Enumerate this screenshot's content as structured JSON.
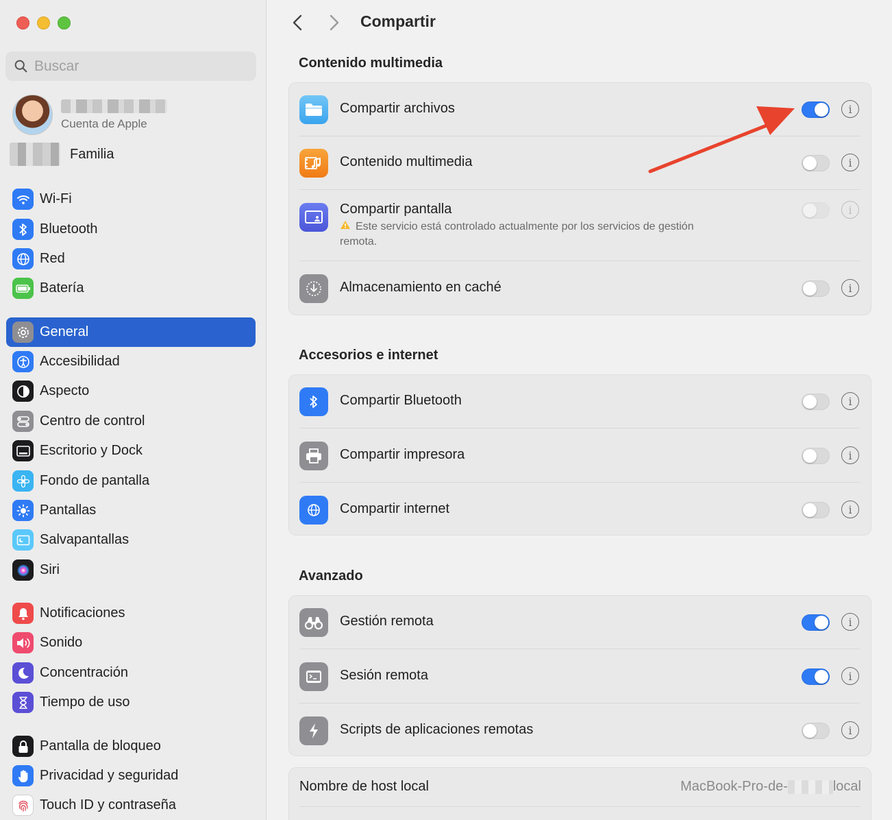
{
  "window": {
    "title": "Compartir"
  },
  "sidebar": {
    "search": {
      "placeholder": "Buscar"
    },
    "account": {
      "subtitle": "Cuenta de Apple"
    },
    "family": {
      "label": "Familia"
    },
    "items": [
      {
        "label": "Wi-Fi",
        "icon": "wifi-icon",
        "color": "#2f7bf5"
      },
      {
        "label": "Bluetooth",
        "icon": "bluetooth-icon",
        "color": "#2f7bf5"
      },
      {
        "label": "Red",
        "icon": "globe-icon",
        "color": "#2f7bf5"
      },
      {
        "label": "Batería",
        "icon": "battery-icon",
        "color": "#4cc34a"
      },
      {
        "label": "General",
        "icon": "gear-icon",
        "color": "#8e8e93",
        "selected": true
      },
      {
        "label": "Accesibilidad",
        "icon": "accessibility-icon",
        "color": "#2f7bf5"
      },
      {
        "label": "Aspecto",
        "icon": "appearance-icon",
        "color": "#1c1c1e"
      },
      {
        "label": "Centro de control",
        "icon": "control-center-icon",
        "color": "#8e8e93"
      },
      {
        "label": "Escritorio y Dock",
        "icon": "dock-icon",
        "color": "#1c1c1e"
      },
      {
        "label": "Fondo de pantalla",
        "icon": "wallpaper-icon",
        "color": "#3ab4f2"
      },
      {
        "label": "Pantallas",
        "icon": "display-icon",
        "color": "#2f7bf5"
      },
      {
        "label": "Salvapantallas",
        "icon": "screensaver-icon",
        "color": "#5ac8fa"
      },
      {
        "label": "Siri",
        "icon": "siri-icon",
        "color": "#1c1c1e"
      },
      {
        "label": "Notificaciones",
        "icon": "bell-icon",
        "color": "#ef4b4b"
      },
      {
        "label": "Sonido",
        "icon": "speaker-icon",
        "color": "#ef4b6e"
      },
      {
        "label": "Concentración",
        "icon": "moon-icon",
        "color": "#5b4fd6"
      },
      {
        "label": "Tiempo de uso",
        "icon": "hourglass-icon",
        "color": "#5b4fd6"
      },
      {
        "label": "Pantalla de bloqueo",
        "icon": "lock-icon",
        "color": "#1c1c1e"
      },
      {
        "label": "Privacidad y seguridad",
        "icon": "hand-icon",
        "color": "#2f7bf5"
      },
      {
        "label": "Touch ID y contraseña",
        "icon": "fingerprint-icon",
        "color": "#ffffff"
      }
    ]
  },
  "sections": {
    "media": {
      "title": "Contenido multimedia",
      "rows": [
        {
          "label": "Compartir archivos",
          "icon": "folder-icon",
          "enabled": true
        },
        {
          "label": "Contenido multimedia",
          "icon": "media-icon",
          "enabled": false
        },
        {
          "label": "Compartir pantalla",
          "icon": "screen-share-icon",
          "enabled": false,
          "disabled": true,
          "note": "Este servicio está controlado actualmente por los servicios de gestión remota."
        },
        {
          "label": "Almacenamiento en caché",
          "icon": "cache-icon",
          "enabled": false
        }
      ]
    },
    "accessories": {
      "title": "Accesorios e internet",
      "rows": [
        {
          "label": "Compartir Bluetooth",
          "icon": "bluetooth-icon",
          "enabled": false
        },
        {
          "label": "Compartir impresora",
          "icon": "printer-icon",
          "enabled": false
        },
        {
          "label": "Compartir internet",
          "icon": "globe-icon",
          "enabled": false
        }
      ]
    },
    "advanced": {
      "title": "Avanzado",
      "rows": [
        {
          "label": "Gestión remota",
          "icon": "binoculars-icon",
          "enabled": true
        },
        {
          "label": "Sesión remota",
          "icon": "terminal-icon",
          "enabled": true
        },
        {
          "label": "Scripts de aplicaciones remotas",
          "icon": "script-icon",
          "enabled": false
        }
      ]
    },
    "host": {
      "label": "Nombre de host local",
      "value_prefix": "MacBook-Pro-de-",
      "value_suffix": "local"
    }
  },
  "colors": {
    "accent": "#2f7bf5",
    "selection": "#2a63cf",
    "annotation_arrow": "#e8432d"
  }
}
